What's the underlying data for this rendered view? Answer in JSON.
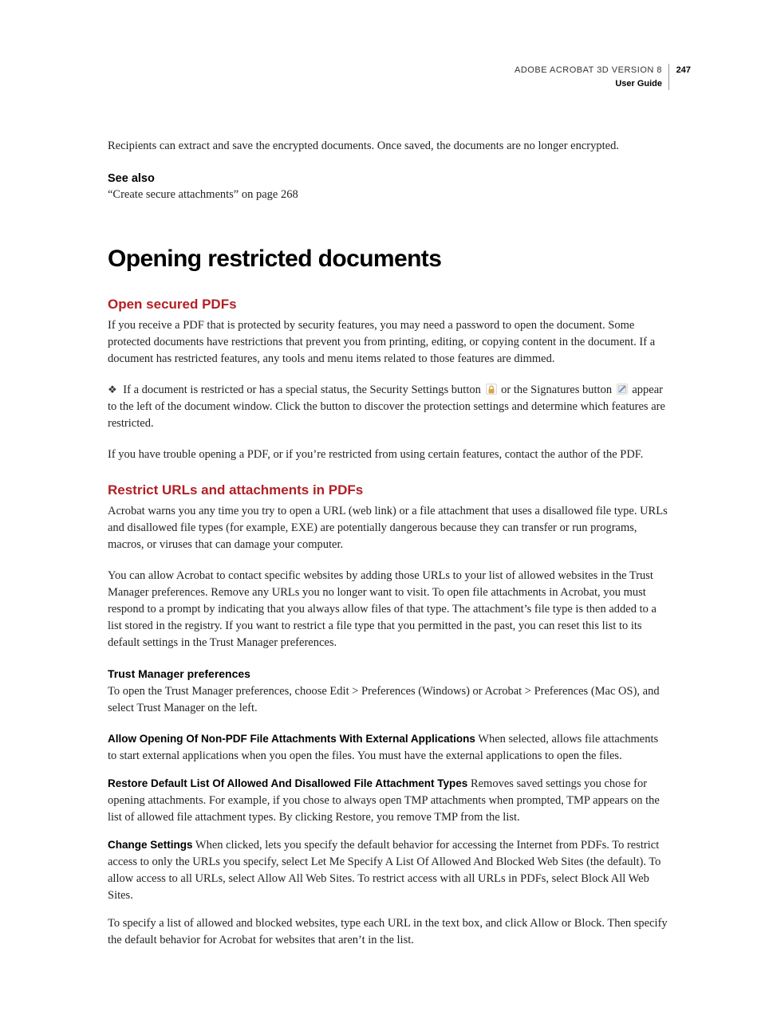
{
  "header": {
    "product": "ADOBE ACROBAT 3D VERSION 8",
    "doc_type": "User Guide",
    "page_number": "247"
  },
  "intro_para": "Recipients can extract and save the encrypted documents. Once saved, the documents are no longer encrypted.",
  "see_also": {
    "heading": "See also",
    "link": "“Create secure attachments” on page 268"
  },
  "main_heading": "Opening restricted documents",
  "section1": {
    "heading": "Open secured PDFs",
    "para1": "If you receive a PDF that is protected by security features, you may need a password to open the document. Some protected documents have restrictions that prevent you from printing, editing, or copying content in the document. If a document has restricted features, any tools and menu items related to those features are dimmed.",
    "bullet_pre": "If a document is restricted or has a special status, the Security Settings button ",
    "bullet_mid": " or the Signatures button ",
    "bullet_post": " appear to the left of the document window. Click the button to discover the protection settings and determine which features are restricted.",
    "para3": "If you have trouble opening a PDF, or if you’re restricted from using certain features, contact the author of the PDF."
  },
  "section2": {
    "heading": "Restrict URLs and attachments in PDFs",
    "para1": "Acrobat warns you any time you try to open a URL (web link) or a file attachment that uses a disallowed file type. URLs and disallowed file types (for example, EXE) are potentially dangerous because they can transfer or run programs, macros, or viruses that can damage your computer.",
    "para2": "You can allow Acrobat to contact specific websites by adding those URLs to your list of allowed websites in the Trust Manager preferences. Remove any URLs you no longer want to visit. To open file attachments in Acrobat, you must respond to a prompt by indicating that you always allow files of that type. The attachment’s file type is then added to a list stored in the registry. If you want to restrict a file type that you permitted in the past, you can reset this list to its default settings in the Trust Manager preferences."
  },
  "section3": {
    "heading": "Trust Manager preferences",
    "para1": "To open the Trust Manager preferences, choose Edit > Preferences (Windows) or Acrobat > Preferences (Mac OS), and select Trust Manager on the left.",
    "def1_label": "Allow Opening Of Non-PDF File Attachments With External Applications",
    "def1_text": "  When selected, allows file attachments to start external applications when you open the files. You must have the external applications to open the files.",
    "def2_label": "Restore Default List Of Allowed And Disallowed File Attachment Types",
    "def2_text": "   Removes saved settings you chose for opening attachments. For example, if you chose to always open TMP attachments when prompted, TMP appears on the list of allowed file attachment types. By clicking Restore, you remove TMP from the list.",
    "def3_label": "Change Settings",
    "def3_text": "   When clicked, lets you specify the default behavior for accessing the Internet from PDFs. To restrict access to only the URLs you specify, select Let Me Specify A List Of Allowed And Blocked Web Sites (the default). To allow access to all URLs, select Allow All Web Sites. To restrict access with all URLs in PDFs, select Block All Web Sites.",
    "para_final": "To specify a list of allowed and blocked websites, type each URL in the text box, and click Allow or Block. Then specify the default behavior for Acrobat for websites that aren’t in the list."
  }
}
